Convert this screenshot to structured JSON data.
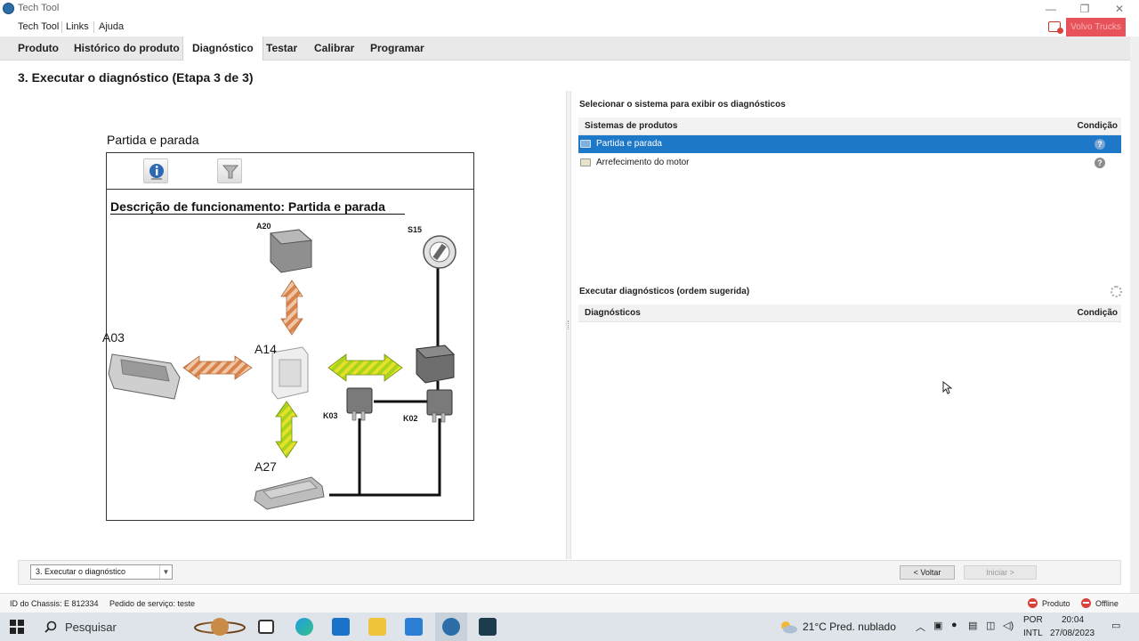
{
  "window": {
    "title": "Tech Tool"
  },
  "menu": {
    "items": [
      "Tech Tool",
      "Links",
      "Ajuda"
    ],
    "brand_label": "Volvo Trucks"
  },
  "tabs": [
    "Produto",
    "Histórico do produto",
    "Diagnóstico",
    "Testar",
    "Calibrar",
    "Programar"
  ],
  "active_tab": "Diagnóstico",
  "step_title": "3. Executar o diagnóstico (Etapa 3 de 3)",
  "diagram": {
    "heading": "Partida e parada",
    "description_title": "Descrição de funcionamento: Partida e parada",
    "components": {
      "a20": "A20",
      "s15": "S15",
      "a03": "A03",
      "a14": "A14",
      "k03": "K03",
      "k02": "K02",
      "a27": "A27"
    }
  },
  "systems_panel": {
    "label": "Selecionar o sistema para exibir os diagnósticos",
    "col_system": "Sistemas de produtos",
    "col_condition": "Condição",
    "rows": [
      {
        "name": "Partida e parada",
        "condition": "?",
        "selected": true
      },
      {
        "name": "Arrefecimento do motor",
        "condition": "?",
        "selected": false
      }
    ]
  },
  "diagnostics_panel": {
    "label": "Executar diagnósticos (ordem sugerida)",
    "col_diag": "Diagnósticos",
    "col_condition": "Condição"
  },
  "bottom": {
    "step_select_value": "3. Executar o diagnóstico",
    "back_label": "< Voltar",
    "start_label": "Iniciar >"
  },
  "status": {
    "chassis": "ID do Chassis: E 812334",
    "order": "Pedido de serviço: teste",
    "product": "Produto",
    "offline": "Offline"
  },
  "taskbar": {
    "search_placeholder": "Pesquisar",
    "weather": "21°C  Pred. nublado",
    "lang_top": "POR",
    "lang_bottom": "INTL",
    "time": "20:04",
    "date": "27/08/2023"
  },
  "colors": {
    "accent_blue": "#1e78c8",
    "brand_red": "#e8525a",
    "arrow_orange": "#d9824a",
    "arrow_green": "#a8d41c",
    "arrow_yellow": "#e6e02a"
  }
}
